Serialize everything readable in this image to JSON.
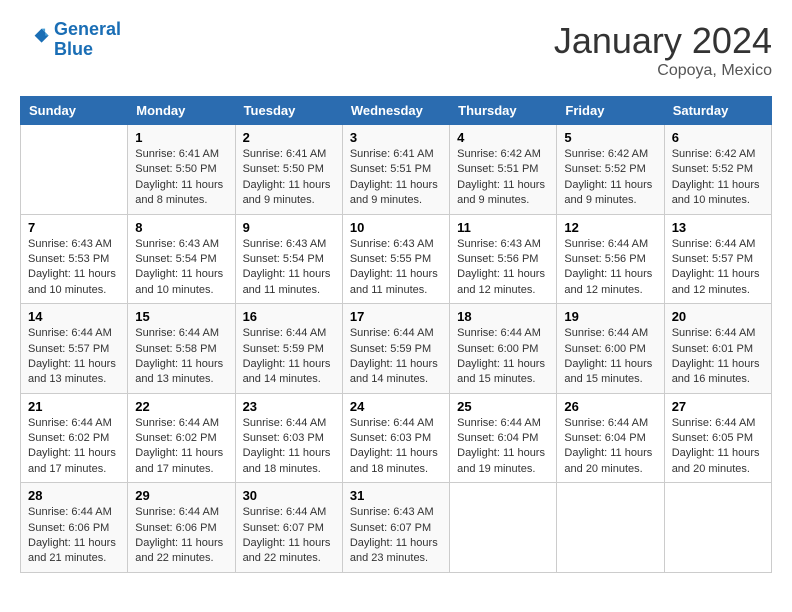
{
  "header": {
    "logo_line1": "General",
    "logo_line2": "Blue",
    "month": "January 2024",
    "location": "Copoya, Mexico"
  },
  "days_of_week": [
    "Sunday",
    "Monday",
    "Tuesday",
    "Wednesday",
    "Thursday",
    "Friday",
    "Saturday"
  ],
  "weeks": [
    [
      {
        "day": "",
        "sunrise": "",
        "sunset": "",
        "daylight": ""
      },
      {
        "day": "1",
        "sunrise": "Sunrise: 6:41 AM",
        "sunset": "Sunset: 5:50 PM",
        "daylight": "Daylight: 11 hours and 8 minutes."
      },
      {
        "day": "2",
        "sunrise": "Sunrise: 6:41 AM",
        "sunset": "Sunset: 5:50 PM",
        "daylight": "Daylight: 11 hours and 9 minutes."
      },
      {
        "day": "3",
        "sunrise": "Sunrise: 6:41 AM",
        "sunset": "Sunset: 5:51 PM",
        "daylight": "Daylight: 11 hours and 9 minutes."
      },
      {
        "day": "4",
        "sunrise": "Sunrise: 6:42 AM",
        "sunset": "Sunset: 5:51 PM",
        "daylight": "Daylight: 11 hours and 9 minutes."
      },
      {
        "day": "5",
        "sunrise": "Sunrise: 6:42 AM",
        "sunset": "Sunset: 5:52 PM",
        "daylight": "Daylight: 11 hours and 9 minutes."
      },
      {
        "day": "6",
        "sunrise": "Sunrise: 6:42 AM",
        "sunset": "Sunset: 5:52 PM",
        "daylight": "Daylight: 11 hours and 10 minutes."
      }
    ],
    [
      {
        "day": "7",
        "sunrise": "Sunrise: 6:43 AM",
        "sunset": "Sunset: 5:53 PM",
        "daylight": "Daylight: 11 hours and 10 minutes."
      },
      {
        "day": "8",
        "sunrise": "Sunrise: 6:43 AM",
        "sunset": "Sunset: 5:54 PM",
        "daylight": "Daylight: 11 hours and 10 minutes."
      },
      {
        "day": "9",
        "sunrise": "Sunrise: 6:43 AM",
        "sunset": "Sunset: 5:54 PM",
        "daylight": "Daylight: 11 hours and 11 minutes."
      },
      {
        "day": "10",
        "sunrise": "Sunrise: 6:43 AM",
        "sunset": "Sunset: 5:55 PM",
        "daylight": "Daylight: 11 hours and 11 minutes."
      },
      {
        "day": "11",
        "sunrise": "Sunrise: 6:43 AM",
        "sunset": "Sunset: 5:56 PM",
        "daylight": "Daylight: 11 hours and 12 minutes."
      },
      {
        "day": "12",
        "sunrise": "Sunrise: 6:44 AM",
        "sunset": "Sunset: 5:56 PM",
        "daylight": "Daylight: 11 hours and 12 minutes."
      },
      {
        "day": "13",
        "sunrise": "Sunrise: 6:44 AM",
        "sunset": "Sunset: 5:57 PM",
        "daylight": "Daylight: 11 hours and 12 minutes."
      }
    ],
    [
      {
        "day": "14",
        "sunrise": "Sunrise: 6:44 AM",
        "sunset": "Sunset: 5:57 PM",
        "daylight": "Daylight: 11 hours and 13 minutes."
      },
      {
        "day": "15",
        "sunrise": "Sunrise: 6:44 AM",
        "sunset": "Sunset: 5:58 PM",
        "daylight": "Daylight: 11 hours and 13 minutes."
      },
      {
        "day": "16",
        "sunrise": "Sunrise: 6:44 AM",
        "sunset": "Sunset: 5:59 PM",
        "daylight": "Daylight: 11 hours and 14 minutes."
      },
      {
        "day": "17",
        "sunrise": "Sunrise: 6:44 AM",
        "sunset": "Sunset: 5:59 PM",
        "daylight": "Daylight: 11 hours and 14 minutes."
      },
      {
        "day": "18",
        "sunrise": "Sunrise: 6:44 AM",
        "sunset": "Sunset: 6:00 PM",
        "daylight": "Daylight: 11 hours and 15 minutes."
      },
      {
        "day": "19",
        "sunrise": "Sunrise: 6:44 AM",
        "sunset": "Sunset: 6:00 PM",
        "daylight": "Daylight: 11 hours and 15 minutes."
      },
      {
        "day": "20",
        "sunrise": "Sunrise: 6:44 AM",
        "sunset": "Sunset: 6:01 PM",
        "daylight": "Daylight: 11 hours and 16 minutes."
      }
    ],
    [
      {
        "day": "21",
        "sunrise": "Sunrise: 6:44 AM",
        "sunset": "Sunset: 6:02 PM",
        "daylight": "Daylight: 11 hours and 17 minutes."
      },
      {
        "day": "22",
        "sunrise": "Sunrise: 6:44 AM",
        "sunset": "Sunset: 6:02 PM",
        "daylight": "Daylight: 11 hours and 17 minutes."
      },
      {
        "day": "23",
        "sunrise": "Sunrise: 6:44 AM",
        "sunset": "Sunset: 6:03 PM",
        "daylight": "Daylight: 11 hours and 18 minutes."
      },
      {
        "day": "24",
        "sunrise": "Sunrise: 6:44 AM",
        "sunset": "Sunset: 6:03 PM",
        "daylight": "Daylight: 11 hours and 18 minutes."
      },
      {
        "day": "25",
        "sunrise": "Sunrise: 6:44 AM",
        "sunset": "Sunset: 6:04 PM",
        "daylight": "Daylight: 11 hours and 19 minutes."
      },
      {
        "day": "26",
        "sunrise": "Sunrise: 6:44 AM",
        "sunset": "Sunset: 6:04 PM",
        "daylight": "Daylight: 11 hours and 20 minutes."
      },
      {
        "day": "27",
        "sunrise": "Sunrise: 6:44 AM",
        "sunset": "Sunset: 6:05 PM",
        "daylight": "Daylight: 11 hours and 20 minutes."
      }
    ],
    [
      {
        "day": "28",
        "sunrise": "Sunrise: 6:44 AM",
        "sunset": "Sunset: 6:06 PM",
        "daylight": "Daylight: 11 hours and 21 minutes."
      },
      {
        "day": "29",
        "sunrise": "Sunrise: 6:44 AM",
        "sunset": "Sunset: 6:06 PM",
        "daylight": "Daylight: 11 hours and 22 minutes."
      },
      {
        "day": "30",
        "sunrise": "Sunrise: 6:44 AM",
        "sunset": "Sunset: 6:07 PM",
        "daylight": "Daylight: 11 hours and 22 minutes."
      },
      {
        "day": "31",
        "sunrise": "Sunrise: 6:43 AM",
        "sunset": "Sunset: 6:07 PM",
        "daylight": "Daylight: 11 hours and 23 minutes."
      },
      {
        "day": "",
        "sunrise": "",
        "sunset": "",
        "daylight": ""
      },
      {
        "day": "",
        "sunrise": "",
        "sunset": "",
        "daylight": ""
      },
      {
        "day": "",
        "sunrise": "",
        "sunset": "",
        "daylight": ""
      }
    ]
  ]
}
